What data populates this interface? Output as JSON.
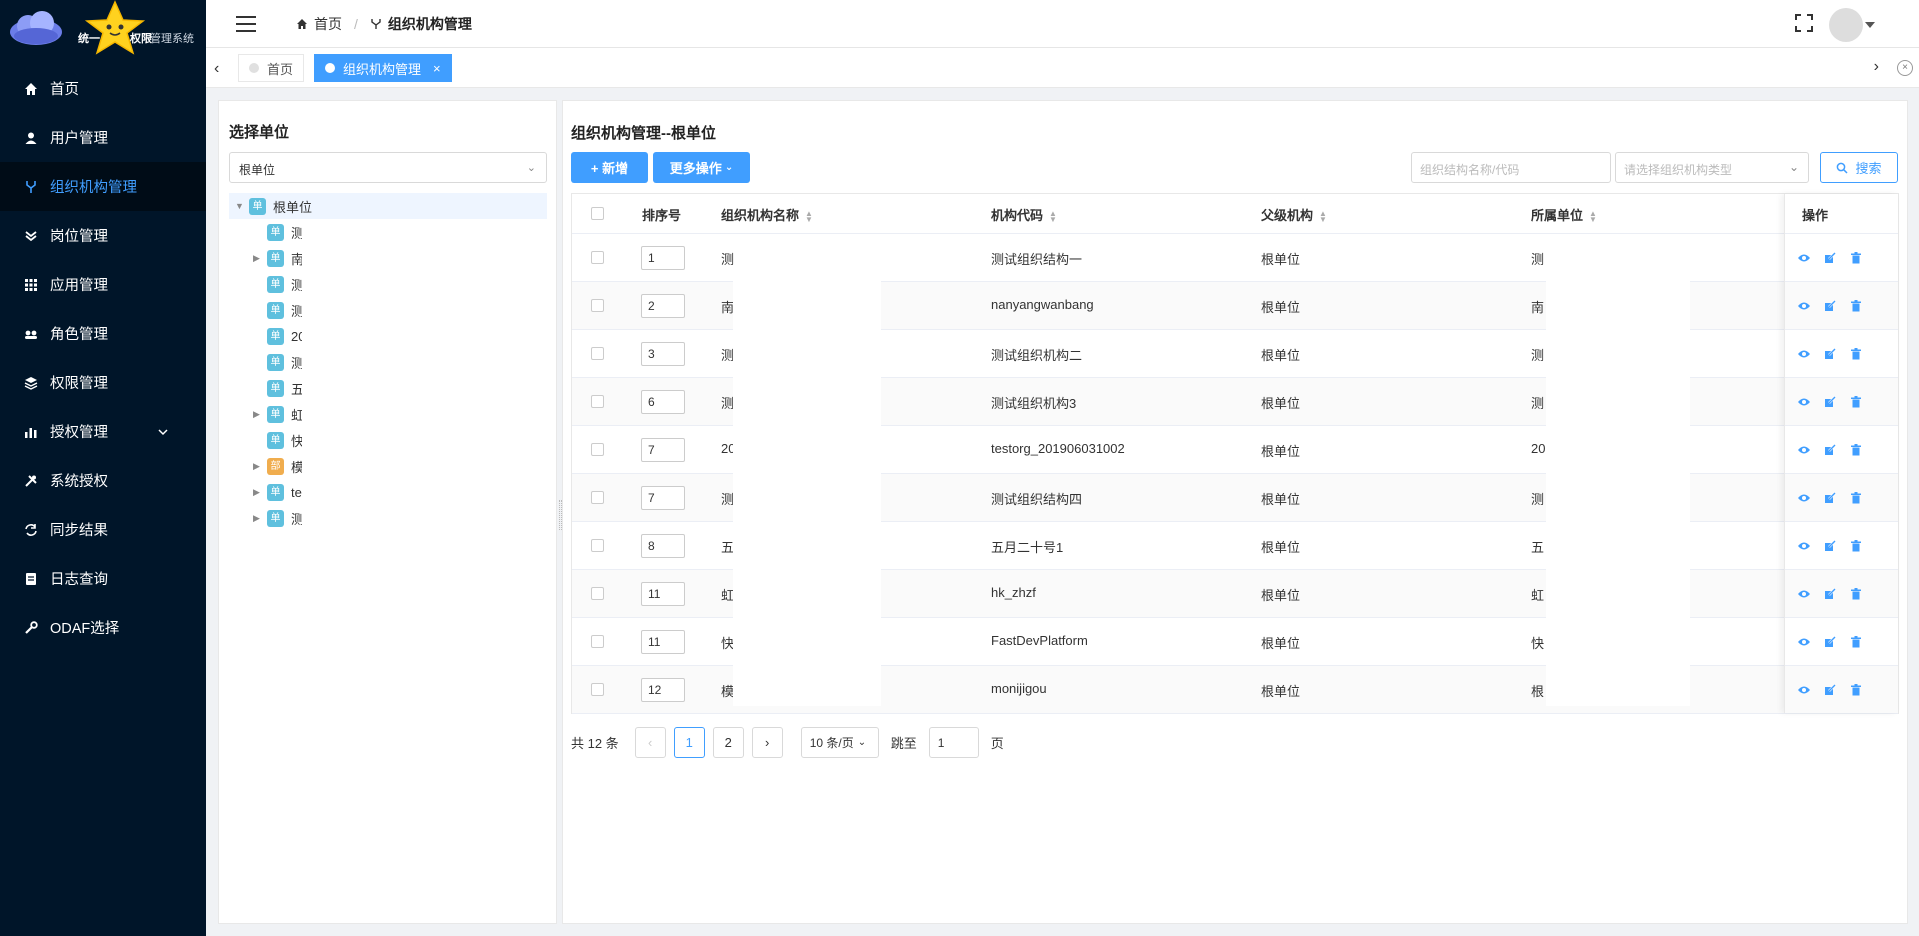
{
  "app": {
    "title_prefix": "统一",
    "title_mid": "权限",
    "title_suffix": "管理系统"
  },
  "sidebar": {
    "items": [
      {
        "label": "首页",
        "icon": "home-icon"
      },
      {
        "label": "用户管理",
        "icon": "user-icon"
      },
      {
        "label": "组织机构管理",
        "icon": "org-icon",
        "active": true
      },
      {
        "label": "岗位管理",
        "icon": "post-icon"
      },
      {
        "label": "应用管理",
        "icon": "apps-icon"
      },
      {
        "label": "角色管理",
        "icon": "role-icon"
      },
      {
        "label": "权限管理",
        "icon": "layers-icon"
      },
      {
        "label": "授权管理",
        "icon": "chart-icon",
        "expandable": true
      },
      {
        "label": "系统授权",
        "icon": "tools-icon"
      },
      {
        "label": "同步结果",
        "icon": "sync-icon"
      },
      {
        "label": "日志查询",
        "icon": "log-icon"
      },
      {
        "label": "ODAF选择",
        "icon": "wrench-icon"
      }
    ]
  },
  "breadcrumb": {
    "home": "首页",
    "sep": "/",
    "current": "组织机构管理"
  },
  "tabs": [
    {
      "label": "首页",
      "active": false
    },
    {
      "label": "组织机构管理",
      "active": true,
      "close": "×"
    }
  ],
  "left_panel": {
    "title": "选择单位",
    "select_value": "根单位",
    "tree": [
      {
        "label": "根单位",
        "badge": "单",
        "root": true,
        "expanded": true
      },
      {
        "label": "测",
        "badge": "单"
      },
      {
        "label": "南",
        "badge": "单",
        "expandable": true
      },
      {
        "label": "测",
        "badge": "单"
      },
      {
        "label": "测",
        "badge": "单"
      },
      {
        "label": "20",
        "badge": "单"
      },
      {
        "label": "测",
        "badge": "单"
      },
      {
        "label": "五",
        "badge": "单"
      },
      {
        "label": "虹",
        "badge": "单",
        "expandable": true
      },
      {
        "label": "快",
        "badge": "单"
      },
      {
        "label": "模",
        "badge": "部",
        "expandable": true,
        "orange": true
      },
      {
        "label": "te",
        "badge": "单",
        "expandable": true
      },
      {
        "label": "测",
        "badge": "单",
        "expandable": true
      }
    ]
  },
  "main": {
    "title": "组织机构管理--根单位",
    "add_button": "+ 新增",
    "more_button": "更多操作",
    "search_placeholder": "组织结构名称/代码",
    "type_placeholder": "请选择组织机构类型",
    "search_button": "搜索",
    "columns": {
      "order": "排序号",
      "name": "组织机构名称",
      "code": "机构代码",
      "parent": "父级机构",
      "unit": "所属单位",
      "ops": "操作"
    },
    "rows": [
      {
        "order": "1",
        "name": "测",
        "code": "测试组织结构一",
        "parent": "根单位",
        "unit": "测"
      },
      {
        "order": "2",
        "name": "南",
        "code": "nanyangwanbang",
        "parent": "根单位",
        "unit": "南"
      },
      {
        "order": "3",
        "name": "测",
        "code": "测试组织机构二",
        "parent": "根单位",
        "unit": "测"
      },
      {
        "order": "6",
        "name": "测",
        "code": "测试组织机构3",
        "parent": "根单位",
        "unit": "测"
      },
      {
        "order": "7",
        "name": "20",
        "code": "testorg_201906031002",
        "parent": "根单位",
        "unit": "20"
      },
      {
        "order": "7",
        "name": "测",
        "code": "测试组织结构四",
        "parent": "根单位",
        "unit": "测"
      },
      {
        "order": "8",
        "name": "五",
        "code": "五月二十号1",
        "parent": "根单位",
        "unit": "五"
      },
      {
        "order": "11",
        "name": "虹",
        "code": "hk_zhzf",
        "parent": "根单位",
        "unit": "虹"
      },
      {
        "order": "11",
        "name": "快",
        "code": "FastDevPlatform",
        "parent": "根单位",
        "unit": "快"
      },
      {
        "order": "12",
        "name": "模",
        "code": "monijigou",
        "parent": "根单位",
        "unit": "根"
      }
    ],
    "pager": {
      "total_text": "共 12 条",
      "pages": [
        "1",
        "2"
      ],
      "current": "1",
      "size": "10 条/页",
      "jump_label": "跳至",
      "jump_value": "1",
      "page_suffix": "页"
    }
  },
  "colors": {
    "accent": "#409eff",
    "sidebar_bg": "#001529"
  }
}
